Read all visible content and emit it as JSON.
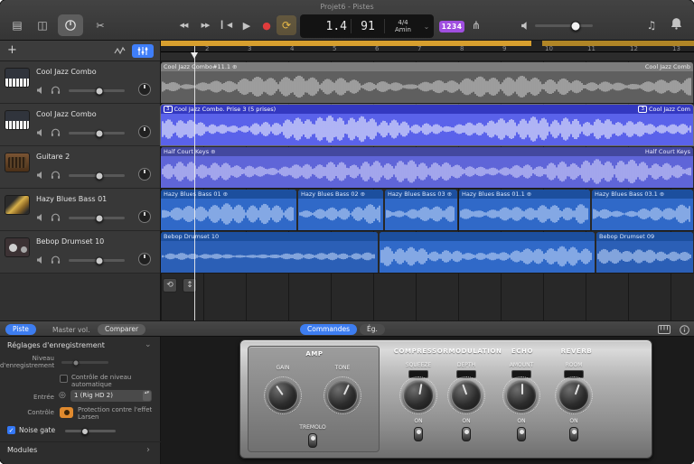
{
  "window": {
    "title": "Projet6 - Pistes"
  },
  "toolbar": {
    "lcd": {
      "position": "1.4",
      "tempo": "91",
      "time_signature": "4/4",
      "key": "Amin"
    },
    "count_in": "1234"
  },
  "ruler": {
    "bars": [
      "2",
      "3",
      "4",
      "5",
      "6",
      "7",
      "8",
      "9",
      "10",
      "11",
      "12",
      "13"
    ]
  },
  "sidebar": {
    "tracks": [
      {
        "name": "Cool Jazz Combo"
      },
      {
        "name": "Cool Jazz Combo"
      },
      {
        "name": "Guitare 2"
      },
      {
        "name": "Hazy Blues Bass 01"
      },
      {
        "name": "Bebop Drumset 10"
      }
    ]
  },
  "lanes": {
    "lane1": {
      "name": "Cool Jazz Combo#11.1",
      "right_name": "Cool Jazz Comb"
    },
    "lane2": {
      "badge": "3",
      "name": "Cool Jazz Combo. Prise 3 (5 prises)",
      "right_badge": "3",
      "right_name": "Cool Jazz Com"
    },
    "lane3": {
      "name": "Half Court Keys",
      "right_name": "Half Court Keys"
    },
    "lane4": [
      {
        "name": "Hazy Blues Bass 01"
      },
      {
        "name": "Hazy Blues Bass 02"
      },
      {
        "name": "Hazy Blues Bass 03"
      },
      {
        "name": "Hazy Blues Bass 01.1"
      },
      {
        "name": "Hazy Blues Bass 03.1"
      }
    ],
    "lane5": [
      {
        "name": "Bebop Drumset 10"
      },
      {
        "name": ""
      },
      {
        "name": "Bebop Drumset 09"
      }
    ]
  },
  "bottom_bar": {
    "track_tab": "Piste",
    "master_label": "Master vol.",
    "compare_button": "Comparer",
    "controls_tab": "Commandes",
    "eq_tab": "Ég."
  },
  "settings": {
    "header": "Réglages d'enregistrement",
    "record_level": "Niveau d'enregistrement",
    "auto_level": "Contrôle de niveau automatique",
    "input_label": "Entrée",
    "input_value": "1 (Rig HD 2)",
    "monitor_label": "Contrôle",
    "feedback_protection": "Protection contre l'effet Larsen",
    "noise_gate": "Noise gate",
    "plugins": "Modules"
  },
  "amp": {
    "amp_title": "AMP",
    "compressor_title": "COMPRESSOR",
    "modulation_title": "MODULATION",
    "echo_title": "ECHO",
    "reverb_title": "REVERB",
    "gain": "GAIN",
    "tone": "TONE",
    "squeeze": "SQUEEZE",
    "depth": "DEPTH",
    "amount": "AMOUNT",
    "room": "ROOM",
    "tremolo": "TREMOLO",
    "on": "ON"
  },
  "icons": {
    "library": "▤",
    "browser": "◫",
    "scissors": "✂",
    "rewind": "◀◀",
    "forward": "▶▶",
    "to_start": "▎◀",
    "play": "▶",
    "record": "●",
    "cycle": "⟳",
    "tuning_fork": "⋔",
    "loop_browser": "♫",
    "plus": "+",
    "loop_badge": "⊕",
    "chevron_down": "⌄",
    "chevron_right": "›",
    "check": "✓",
    "input_format": "◎",
    "stepper": "▴▾",
    "tool_loop": "⟲",
    "tool_move": "↕"
  }
}
